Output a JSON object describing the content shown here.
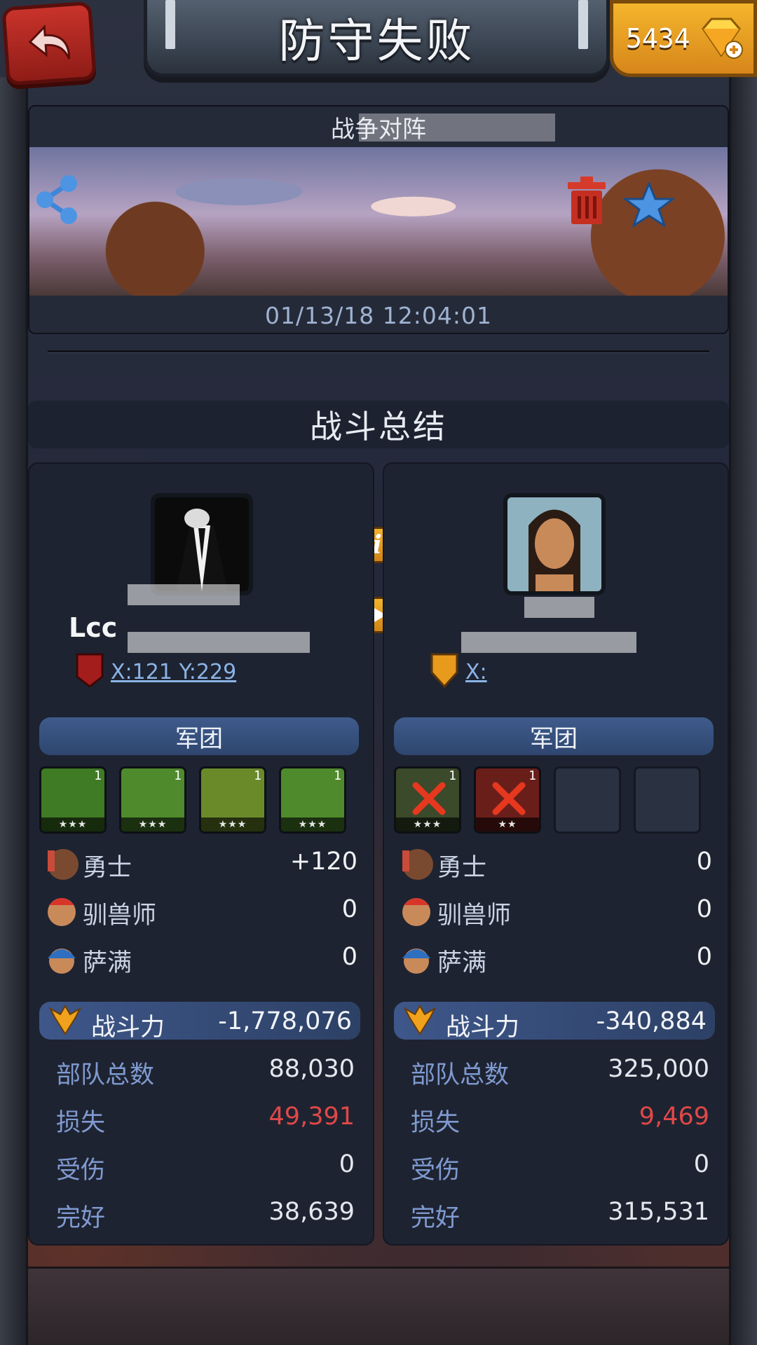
{
  "header": {
    "title": "防守失败",
    "gems": "5434",
    "back_icon": "back-arrow-icon",
    "gem_icon": "diamond-plus-icon"
  },
  "report": {
    "caption": "战争对阵",
    "datetime": "01/13/18 12:04:01"
  },
  "summary": {
    "title": "战斗总结"
  },
  "attacker": {
    "name": "Lcc",
    "coord": "X:121 Y:229",
    "legion_label": "军团",
    "heroes": [
      {
        "level": "1",
        "stars": "★★★",
        "color": "#3f7a24",
        "alive": true
      },
      {
        "level": "1",
        "stars": "★★★",
        "color": "#4f8a2c",
        "alive": true
      },
      {
        "level": "1",
        "stars": "★★★",
        "color": "#6a8a2a",
        "alive": true
      },
      {
        "level": "1",
        "stars": "★★★",
        "color": "#4f8a2c",
        "alive": true
      }
    ],
    "units": [
      {
        "name": "勇士",
        "value": "+120"
      },
      {
        "name": "驯兽师",
        "value": "0"
      },
      {
        "name": "萨满",
        "value": "0"
      }
    ],
    "power_label": "战斗力",
    "power": "-1,778,076",
    "stats": [
      {
        "label": "部队总数",
        "value": "88,030",
        "highlight": false
      },
      {
        "label": "损失",
        "value": "49,391",
        "highlight": true
      },
      {
        "label": "受伤",
        "value": "0",
        "highlight": false
      },
      {
        "label": "完好",
        "value": "38,639",
        "highlight": false
      }
    ]
  },
  "defender": {
    "coord": "X:",
    "legion_label": "军团",
    "heroes": [
      {
        "level": "1",
        "stars": "★★★",
        "color": "#3b4a2a",
        "alive": false
      },
      {
        "level": "1",
        "stars": "★★",
        "color": "#6a1e1a",
        "alive": false
      },
      {
        "empty": true
      },
      {
        "empty": true
      }
    ],
    "units": [
      {
        "name": "勇士",
        "value": "0"
      },
      {
        "name": "驯兽师",
        "value": "0"
      },
      {
        "name": "萨满",
        "value": "0"
      }
    ],
    "power_label": "战斗力",
    "power": "-340,884",
    "stats": [
      {
        "label": "部队总数",
        "value": "325,000",
        "highlight": false
      },
      {
        "label": "损失",
        "value": "9,469",
        "highlight": true
      },
      {
        "label": "受伤",
        "value": "0",
        "highlight": false
      },
      {
        "label": "完好",
        "value": "315,531",
        "highlight": false
      }
    ]
  },
  "colors": {
    "loss": "#e04848",
    "stat_label": "#7f9ad0",
    "pill": "#3f5b8c",
    "gold": "#f2b32c"
  }
}
